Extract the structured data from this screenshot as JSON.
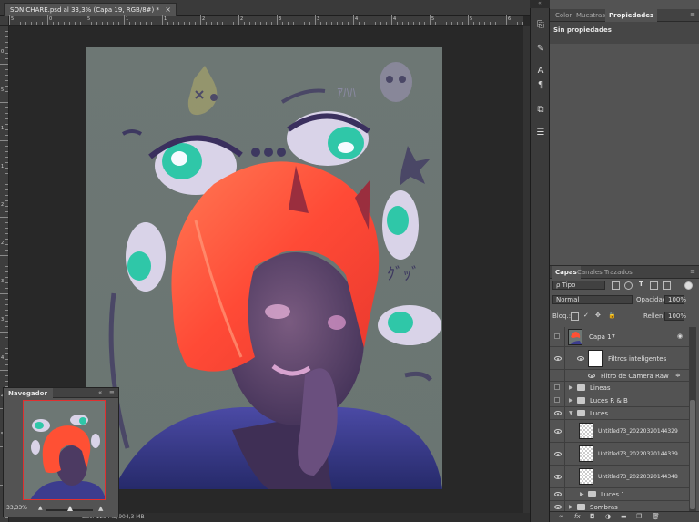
{
  "document": {
    "tab_title": "SON CHARE.psd al 33,3% (Capa 19, RGB/8#) *",
    "close_glyph": "×"
  },
  "ruler": {
    "top_labels": [
      "5",
      "0",
      "5",
      "1",
      "1",
      "2",
      "2",
      "3",
      "3",
      "4",
      "4",
      "5",
      "5",
      "6"
    ],
    "left_labels": [
      "0",
      "5",
      "1",
      "1",
      "2",
      "2",
      "3",
      "3",
      "4",
      "4",
      "5"
    ]
  },
  "status_bar": {
    "text": "Doc: 123 MB/904,3 MB"
  },
  "navigator": {
    "title": "Navegador",
    "zoom": "33,33%",
    "collapse": "«",
    "menu": "≡"
  },
  "properties_panel": {
    "tabs": [
      "Color",
      "Muestras",
      "Propiedades"
    ],
    "active_tab": "Propiedades",
    "heading": "Sin propiedades",
    "menu": "≡"
  },
  "layers_panel": {
    "tabs": [
      "Capas",
      "Canales",
      "Trazados"
    ],
    "active_tab": "Capas",
    "filter_label": "ρ Tipo",
    "blend_mode": "Normal",
    "opacity_label": "Opacidad:",
    "opacity_value": "100%",
    "lock_label": "Bloq.:",
    "fill_label": "Relleno:",
    "fill_value": "100%",
    "menu": "≡",
    "layers": [
      {
        "name": "Capa 17",
        "kind": "smart",
        "visible": false
      },
      {
        "name": "Filtros inteligentes",
        "kind": "smart-filter-mask",
        "visible": true
      },
      {
        "name": "Filtro de Camera Raw",
        "kind": "filter",
        "visible": true
      },
      {
        "name": "Lineas",
        "kind": "group-closed",
        "visible": false
      },
      {
        "name": "Luces R & B",
        "kind": "group-closed",
        "visible": false
      },
      {
        "name": "Luces",
        "kind": "group-open",
        "visible": true
      },
      {
        "name": "Untitled73_20220320144329",
        "kind": "pixel",
        "visible": true
      },
      {
        "name": "Untitled73_20220320144339",
        "kind": "pixel",
        "visible": true
      },
      {
        "name": "Untitled73_20220320144348",
        "kind": "pixel",
        "visible": true
      },
      {
        "name": "Luces 1",
        "kind": "group-closed",
        "visible": true
      },
      {
        "name": "Sombras",
        "kind": "group-closed",
        "visible": true
      }
    ]
  },
  "colors": {
    "ui_dark": "#282828",
    "panel": "#535353",
    "canvas_bg": "#6f7a78",
    "hair": "#ff5a3c",
    "skin": "#5a3f66",
    "eye_iris": "#2fc7a8",
    "nav_frame": "#e03030"
  }
}
